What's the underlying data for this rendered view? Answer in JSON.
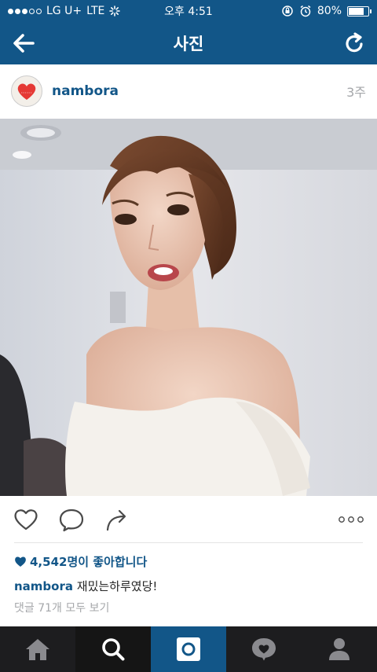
{
  "status": {
    "carrier": "LG U+",
    "network": "LTE",
    "time": "오후 4:51",
    "battery": "80%",
    "battery_level": 0.8
  },
  "nav": {
    "title": "사진",
    "icons": [
      "back-arrow-icon",
      "refresh-icon"
    ]
  },
  "post": {
    "username": "nambora",
    "time_ago": "3주",
    "likes": "4,542명이 좋아합니다",
    "caption_user": "nambora",
    "caption_text": "재밌는하루였당!",
    "comments_link": "댓글 71개 모두 보기"
  },
  "tabs": [
    "home-icon",
    "search-icon",
    "camera-icon",
    "activity-heart-icon",
    "profile-icon"
  ],
  "colors": {
    "brand": "#125688",
    "text": "#262626",
    "muted": "#a5a7aa",
    "tabbar": "#1d1d1f"
  }
}
